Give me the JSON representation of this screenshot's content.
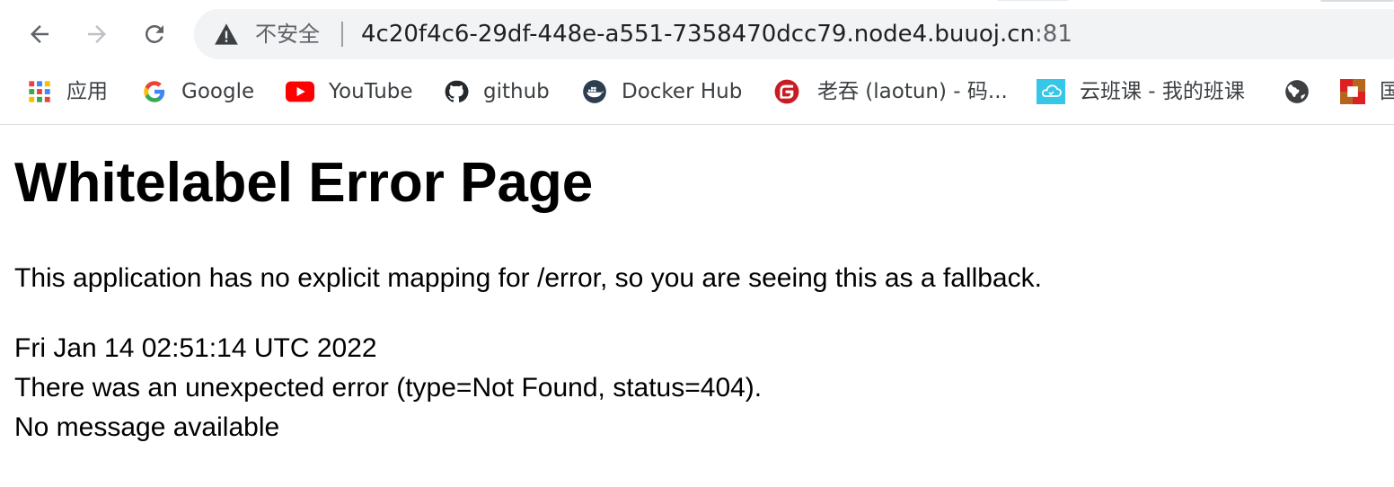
{
  "browser": {
    "security_label": "不安全",
    "url_host": "4c20f4c6-29df-448e-a551-7358470dcc79.node4.buuoj.cn",
    "url_port": ":81",
    "nav_icons": [
      "back-arrow-icon",
      "forward-arrow-icon",
      "reload-icon"
    ],
    "bookmarks": [
      {
        "label": "应用",
        "icon": "apps-grid-icon"
      },
      {
        "label": "Google",
        "icon": "google-icon"
      },
      {
        "label": "YouTube",
        "icon": "youtube-icon"
      },
      {
        "label": "github",
        "icon": "github-icon"
      },
      {
        "label": "Docker Hub",
        "icon": "docker-icon"
      },
      {
        "label": "老吞 (laotun) - 码...",
        "icon": "gitee-icon"
      },
      {
        "label": "云班课 - 我的班课",
        "icon": "cloud-class-icon"
      },
      {
        "label": "",
        "icon": "globe-icon"
      },
      {
        "label": "国",
        "icon": "site-favicon-icon"
      }
    ]
  },
  "page": {
    "title": "Whitelabel Error Page",
    "message": "This application has no explicit mapping for /error, so you are seeing this as a fallback.",
    "timestamp": "Fri Jan 14 02:51:14 UTC 2022",
    "error_line": "There was an unexpected error (type=Not Found, status=404).",
    "detail": "No message available"
  },
  "colors": {
    "omnibox_bg": "#f1f3f4",
    "youtube_red": "#ff0000",
    "gitee_red": "#c71d23",
    "docker_navy": "#2c3e50"
  }
}
